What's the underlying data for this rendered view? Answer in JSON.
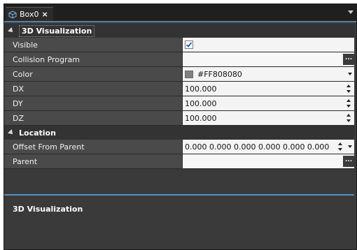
{
  "tab": {
    "title": "Box0",
    "close": "×"
  },
  "categories": {
    "visualization": "3D Visualization",
    "location": "Location"
  },
  "props": {
    "visible": {
      "name": "Visible",
      "checked": true
    },
    "collision": {
      "name": "Collision Program",
      "value": "",
      "button": "..."
    },
    "color": {
      "name": "Color",
      "value": "#FF808080",
      "swatch": "#808080"
    },
    "dx": {
      "name": "DX",
      "value": "100.000"
    },
    "dy": {
      "name": "DY",
      "value": "100.000"
    },
    "dz": {
      "name": "DZ",
      "value": "100.000"
    },
    "offset": {
      "name": "Offset From Parent",
      "value": "0.000 0.000 0.000 0.000 0.000 0.000"
    },
    "parent": {
      "name": "Parent",
      "value": "",
      "button": "..."
    }
  },
  "description": {
    "title": "3D Visualization"
  },
  "colors": {
    "accent": "#3e87c8",
    "panel": "#3a3a3a",
    "name_cell": "#555555",
    "value_cell": "#f4f4f4"
  }
}
